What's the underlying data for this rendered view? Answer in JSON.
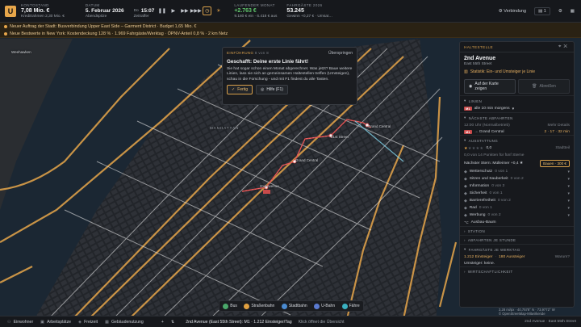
{
  "topbar": {
    "logo": "U",
    "balance_label": "KONTOSTAND",
    "balance_value": "7,08 Mio. €",
    "credit_line": "Kreditrahmen 2,30 Mio. €",
    "date_label": "DATUM",
    "date_value": "5. Februar 2026",
    "time_of_day": "Abendspitze",
    "speed_label": "Zeitraffer",
    "time": "15:07",
    "month_label": "LAUFENDER MONAT",
    "month_value": "+2.763 €",
    "month_detail": "9.180 € ein · 6.418 € aus",
    "passengers_label": "FAHRGÄSTE 2026",
    "passengers_value": "53.245",
    "passengers_detail": "Gewinn +0,27 € · Umsat…",
    "connection": "Verbindung",
    "notifications_count": "1"
  },
  "news": [
    "Neuer Auftrag der Stadt: Busverbindung Upper East Side – Garment District · Budget 1,65 Mio. €",
    "Neue Bestwerte in New York: Kostendeckung 128 % · 1.969 Fahrgäste/Werktag · ÖPNV-Anteil 0,8 % · 2 km Netz"
  ],
  "tutorial": {
    "step_label": "EINFÜHRUNG",
    "step_count": "8 von 8",
    "skip": "Überspringen",
    "title": "Geschafft: Deine erste Linie fährt!",
    "text": "Sie hat sogar schon einen Monat abgerechnet. Was jetzt? Baue weitere Linien, lass sie sich an gemeinsamen Haltestellen treffen (Umsteigen), schau in die Forschung - und mit F1 findest du alle Tasten.",
    "done": "Fertig",
    "help": "Hilfe (F1)"
  },
  "panel": {
    "header": "HALTESTELLE",
    "title": "2nd Avenue",
    "subtitle": "East 55th Street",
    "stat_link": "Statistik: Ein- und Umsteiger je Linie",
    "show_on_map": "Auf der Karte zeigen",
    "cancel": "Abreißen",
    "lines_label": "LINIEN",
    "line_tag": "M1",
    "line_text": "alle 10 min morgens",
    "next_label": "NÄCHSTE ABFAHRTEN",
    "next_time": "12:00 Uhr (Normalbetrieb)",
    "more_details": "Mehr Details",
    "dep_tag": "M1",
    "dep_dest": "→ Grand Central",
    "dep_times": "2 · 17 · 32 min",
    "equip_label": "AUSSTATTUNG",
    "stars_value": "0,0",
    "city_standard": "Stadtteil",
    "stars_hint": "0,0 von 14 Punkten für fünf Sterne",
    "next_star": "Nächster Stern: Mülleimer +0,4 ★",
    "build_btn": "Bauen · 300 €",
    "equipment": [
      {
        "name": "Wetterschutz",
        "level": "0 von 1"
      },
      {
        "name": "Sitzen und Sauberkeit",
        "level": "0 von 2"
      },
      {
        "name": "Information",
        "level": "0 von 3"
      },
      {
        "name": "Sicherheit",
        "level": "0 von 1"
      },
      {
        "name": "Barrierefreiheit",
        "level": "0 von 2"
      },
      {
        "name": "Rad",
        "level": "0 von 1"
      },
      {
        "name": "Werbung",
        "level": "0 von 2"
      }
    ],
    "outdoor_build": "Ausbau-Baum",
    "station_label": "STATION",
    "hours_label": "ABFAHRTEN JE STUNDE",
    "weekday_label": "FAHRGÄSTE JE WERKTAG",
    "boarders": "1.212 Einsteiger",
    "alighters": "180 Aussteiger",
    "why": "Warum?",
    "transfers": "Umsteiger: keine.",
    "economy_label": "WIRTSCHAFTLICHKEIT"
  },
  "map": {
    "labels": [
      "Weehawken",
      "Grand Central",
      "51st Street",
      "2nd Avenue",
      "Grand Central",
      "Grand Ave",
      "MANHATTAN"
    ],
    "scale_text": "3,28 mi/px · 40,7578° N · 73,9772° W",
    "attribution": "© OpenStreetMap-Mitwirkende"
  },
  "modes": [
    "Bus",
    "Straßenbahn",
    "Stadtbahn",
    "U-Bahn",
    "Fähre"
  ],
  "bottombar": {
    "items": [
      "Einwohner",
      "Arbeitsplätze",
      "Freizeit",
      "Gebäudenutzung"
    ],
    "status": "2nd Avenue (East 55th Street): M1 · 1.212 Einsteiger/Tag",
    "hint": "Klick öffnet die Übersicht",
    "right": "2nd Avenue · East 55th Street"
  },
  "colors": {
    "accent": "#e7a64a",
    "line": "#e04a4a",
    "water": "#1a2a38",
    "road": "#f0f0f0"
  }
}
